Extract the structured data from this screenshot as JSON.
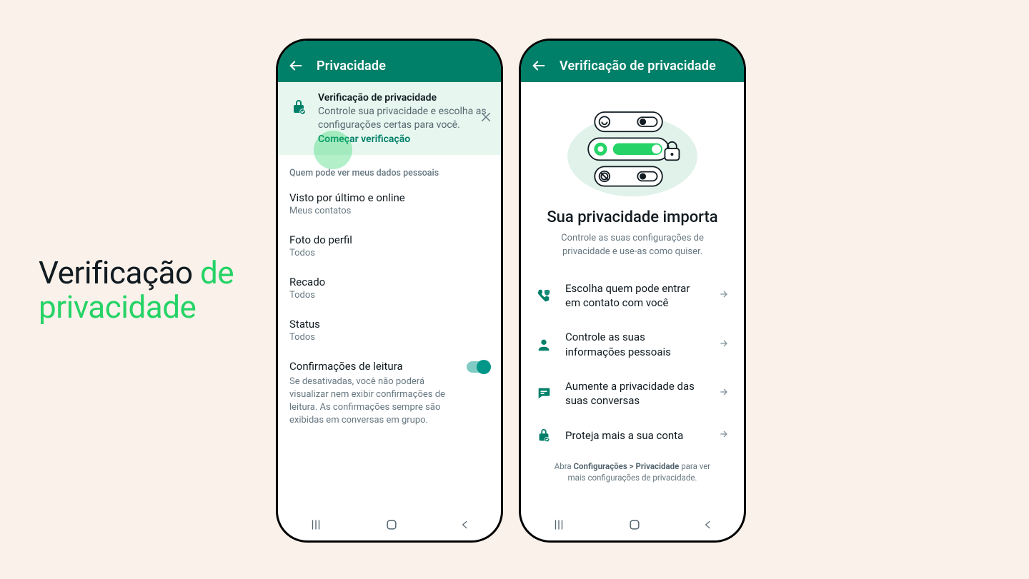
{
  "hero": {
    "t1": "Verificação ",
    "t2": "de",
    "t3": "privacidade"
  },
  "phone1": {
    "title": "Privacidade",
    "banner": {
      "title": "Verificação de privacidade",
      "desc": "Controle sua privacidade e escolha as configurações certas para você.",
      "link": "Começar verificação"
    },
    "section": "Quem pode ver meus dados pessoais",
    "rows": {
      "lastseen": {
        "t": "Visto por último e online",
        "s": "Meus contatos"
      },
      "photo": {
        "t": "Foto do perfil",
        "s": "Todos"
      },
      "about": {
        "t": "Recado",
        "s": "Todos"
      },
      "status": {
        "t": "Status",
        "s": "Todos"
      },
      "read": {
        "t": "Confirmações de leitura",
        "h": "Se desativadas, você não poderá visualizar nem exibir confirmações de leitura. As confirmações sempre são exibidas em conversas em grupo."
      }
    }
  },
  "phone2": {
    "title": "Verificação de privacidade",
    "heading": "Sua privacidade importa",
    "sub": "Controle as suas configurações de privacidade e use-as como quiser.",
    "opts": {
      "contact": "Escolha quem pode entrar em contato com você",
      "info": "Controle as suas informações pessoais",
      "chats": "Aumente a privacidade das suas conversas",
      "account": "Proteja mais a sua conta"
    },
    "footer_pre": "Abra ",
    "footer_bold": "Configurações > Privacidade",
    "footer_post": " para ver mais configurações de privacidade."
  }
}
